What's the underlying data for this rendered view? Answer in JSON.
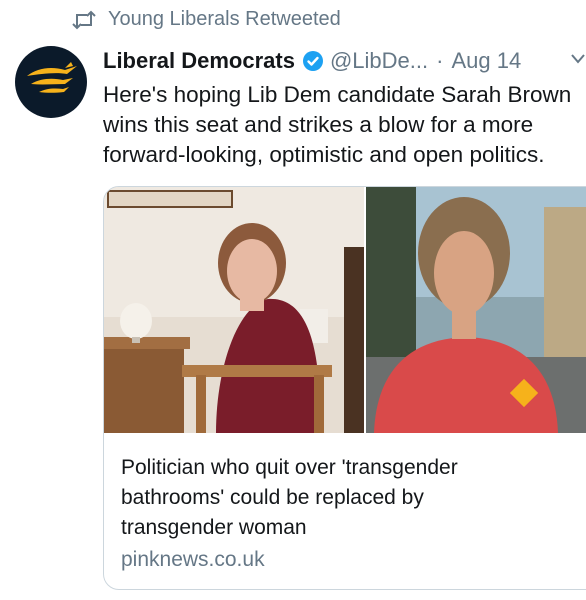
{
  "social_context": {
    "icon": "retweet-icon",
    "text": "Young Liberals Retweeted"
  },
  "tweet": {
    "avatar_icon": "liberal-democrats-bird-logo",
    "author_name": "Liberal Democrats",
    "verified_icon": "verified-badge-icon",
    "handle": "@LibDe...",
    "separator": "·",
    "date": "Aug 14",
    "menu_icon": "chevron-down-icon",
    "text_lines": [
      "Here's hoping Lib Dem candidate Sarah Brown",
      "wins this seat and strikes a blow for a more",
      "forward-looking, optimistic and open politics."
    ]
  },
  "card": {
    "image_description_icon": "photo-collage",
    "title_lines": [
      "Politician who quit over 'transgender",
      "bathrooms' could be replaced by",
      "transgender woman"
    ],
    "domain": "pinknews.co.uk"
  },
  "colors": {
    "text_primary": "#14171a",
    "text_secondary": "#657786",
    "verified_blue": "#1da1f2",
    "logo_bg": "#0b1a2a",
    "logo_gold": "#f6b21b",
    "card_border": "#ccd6dd"
  }
}
